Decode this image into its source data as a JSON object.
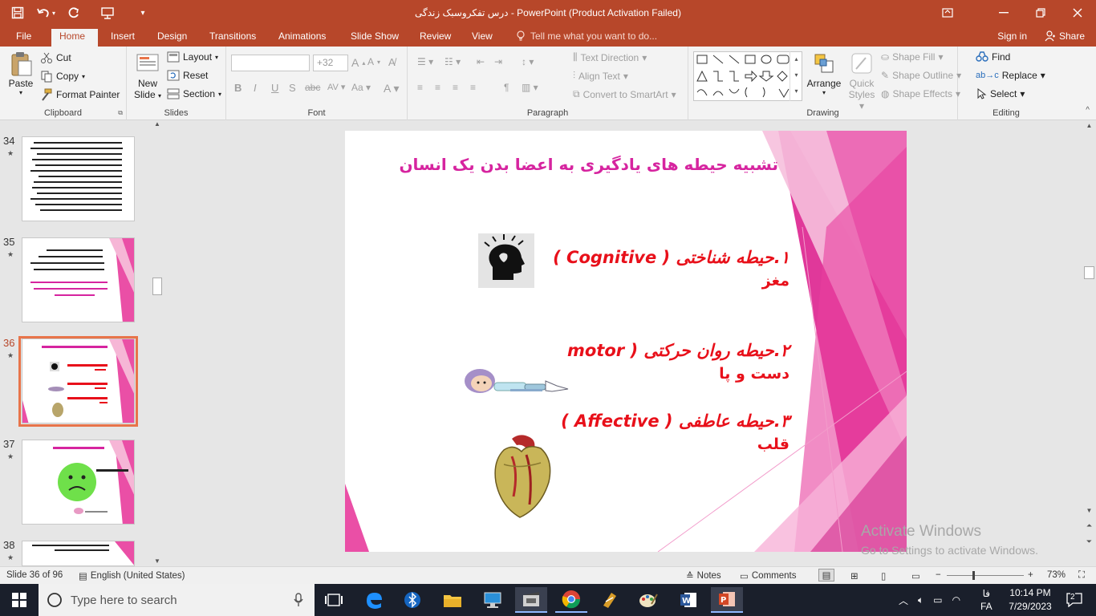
{
  "app": {
    "window_title": "درس تفکروسبک زندگی  -  PowerPoint (Product Activation Failed)"
  },
  "tabs": [
    {
      "label": "File"
    },
    {
      "label": "Home",
      "active": true
    },
    {
      "label": "Insert"
    },
    {
      "label": "Design"
    },
    {
      "label": "Transitions"
    },
    {
      "label": "Animations"
    },
    {
      "label": "Slide Show"
    },
    {
      "label": "Review"
    },
    {
      "label": "View"
    }
  ],
  "tell_me": {
    "placeholder": "Tell me what you want to do..."
  },
  "account": {
    "signin": "Sign in",
    "share": "Share"
  },
  "ribbon": {
    "clipboard": {
      "label": "Clipboard",
      "paste": "Paste",
      "cut": "Cut",
      "copy": "Copy",
      "format_painter": "Format Painter"
    },
    "slides": {
      "label": "Slides",
      "new_slide_1": "New",
      "new_slide_2": "Slide",
      "layout": "Layout",
      "reset": "Reset",
      "section": "Section"
    },
    "font": {
      "label": "Font",
      "font_name": "",
      "font_size": "+32"
    },
    "paragraph": {
      "label": "Paragraph",
      "text_direction": "Text Direction",
      "align_text": "Align Text",
      "smartart": "Convert to SmartArt"
    },
    "drawing": {
      "label": "Drawing",
      "arrange": "Arrange",
      "quick_styles_1": "Quick",
      "quick_styles_2": "Styles",
      "shape_fill": "Shape Fill",
      "shape_outline": "Shape Outline",
      "shape_effects": "Shape Effects"
    },
    "editing": {
      "label": "Editing",
      "find": "Find",
      "replace": "Replace",
      "select": "Select"
    }
  },
  "thumbnails": [
    {
      "num": "34"
    },
    {
      "num": "35"
    },
    {
      "num": "36",
      "current": true
    },
    {
      "num": "37"
    },
    {
      "num": "38"
    }
  ],
  "slide": {
    "title": "تشبیه حیطه های یادگیری به اعضا بدن یک انسان",
    "items": [
      {
        "line1": "۱.حیطه شناختی ( Cognitive )",
        "line2": "مغز"
      },
      {
        "line1": "۲.حیطه روان حرکتی ( motor",
        "line2": "دست و پا"
      },
      {
        "line1": "۳.حیطه عاطفی (  Affective )",
        "line2": "قلب"
      }
    ]
  },
  "watermark": {
    "line1": "Activate Windows",
    "line2": "Go to Settings to activate Windows."
  },
  "status": {
    "slide_info": "Slide 36 of 96",
    "language": "English (United States)",
    "notes": "Notes",
    "comments": "Comments",
    "zoom": "73%"
  },
  "taskbar": {
    "search_placeholder": "Type here to search",
    "lang": "FA",
    "lang_fa": "فا",
    "time": "10:14 PM",
    "date": "7/29/2023",
    "notif_count": "2"
  },
  "colors": {
    "accent": "#b7472a",
    "slide_pink": "#e0389a",
    "text_red": "#e8101a",
    "title_magenta": "#d6249f"
  }
}
